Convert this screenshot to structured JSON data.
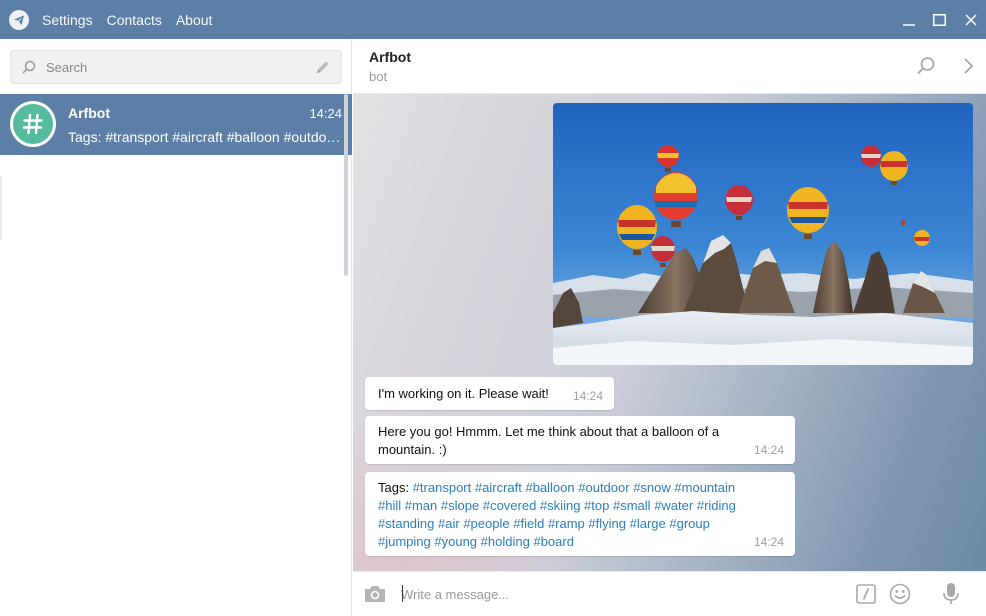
{
  "titlebar": {
    "menu": [
      "Settings",
      "Contacts",
      "About"
    ],
    "background": "#5b7fa6"
  },
  "sidebar": {
    "search": {
      "placeholder": "Search"
    },
    "chats": [
      {
        "name": "Arfbot",
        "time": "14:24",
        "preview": "Tags: #transport #aircraft #balloon #outdoor #snow #mountain #hill #man #slope #covered #skiing #top #small #water #riding #standing #air #people #field #ramp #flying #large #group #jumping #young #holding #board",
        "avatar_icon": "hashtag-icon",
        "avatar_color": "#55bb9f",
        "selected": true
      }
    ]
  },
  "chat": {
    "peer_name": "Arfbot",
    "peer_status": "bot",
    "messages": [
      {
        "type": "photo",
        "description": "hot air balloons over snowy rock formations"
      },
      {
        "type": "text",
        "text": "I'm working on it. Please wait!",
        "time": "14:24"
      },
      {
        "type": "text",
        "text_line1": "Here you go! Hmmm. Let me think about that a balloon of a",
        "text_line2": "mountain. :)",
        "time": "14:24"
      },
      {
        "type": "tags",
        "prefix": "Tags:",
        "tags": [
          "#transport",
          "#aircraft",
          "#balloon",
          "#outdoor",
          "#snow",
          "#mountain",
          "#hill",
          "#man",
          "#slope",
          "#covered",
          "#skiing",
          "#top",
          "#small",
          "#water",
          "#riding",
          "#standing",
          "#air",
          "#people",
          "#field",
          "#ramp",
          "#flying",
          "#large",
          "#group",
          "#jumping",
          "#young",
          "#holding",
          "#board"
        ],
        "time": "14:24"
      }
    ]
  },
  "composer": {
    "placeholder": "Write a message...",
    "value": ""
  },
  "colors": {
    "accent": "#5b7fa6",
    "link": "#2a7fc0",
    "timestamp": "#a0a0a0"
  }
}
